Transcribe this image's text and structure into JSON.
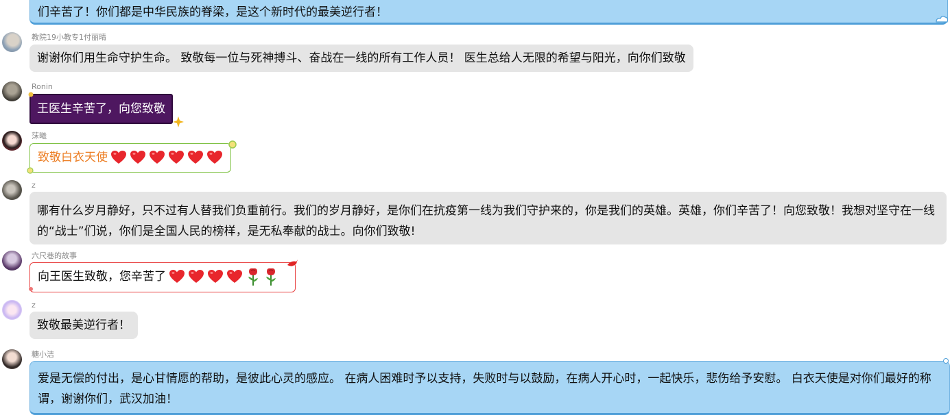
{
  "messages": [
    {
      "name": "",
      "text": "们辛苦了！你们都是中华民族的脊梁，是这个新时代的最美逆行者！"
    },
    {
      "name": "教院19小教专1付丽晴",
      "text": "谢谢你们用生命守护生命。 致敬每一位与死神搏斗、奋战在一线的所有工作人员！ 医生总给人无限的希望与阳光，向你们致敬"
    },
    {
      "name": "Ronin",
      "text": "王医生辛苦了，向您致敬"
    },
    {
      "name": "莯曦",
      "text": "致敬白衣天使"
    },
    {
      "name": "z",
      "text": "哪有什么岁月静好，只不过有人替我们负重前行。我们的岁月静好，是你们在抗疫第一线为我们守护来的，你是我们的英雄。英雄，你们辛苦了！向您致敬！我想对坚守在一线的“战士”们说，你们是全国人民的榜样，是无私奉献的战士。向你们致敬!"
    },
    {
      "name": "六尺巷的故事",
      "text": "向王医生致敬，您辛苦了"
    },
    {
      "name": "z",
      "text": "致敬最美逆行者！"
    },
    {
      "name": "糖小洁",
      "text": "爱是无偿的付出，是心甘情愿的帮助，是彼此心灵的感应。 在病人困难时予以支持，失败时与以鼓励，在病人开心时，一起快乐，悲伤给予安慰。 白衣天使是对你们最好的称谓，谢谢你们，武汉加油！"
    }
  ],
  "emoji": {
    "heart": "heart-emoji",
    "rose": "rose-emoji"
  },
  "colors": {
    "blue_bubble": "#a7d6f5",
    "gray_bubble": "#e5e5e5",
    "purple_bubble": "#4e1760",
    "orange_text": "#ec7d22"
  }
}
